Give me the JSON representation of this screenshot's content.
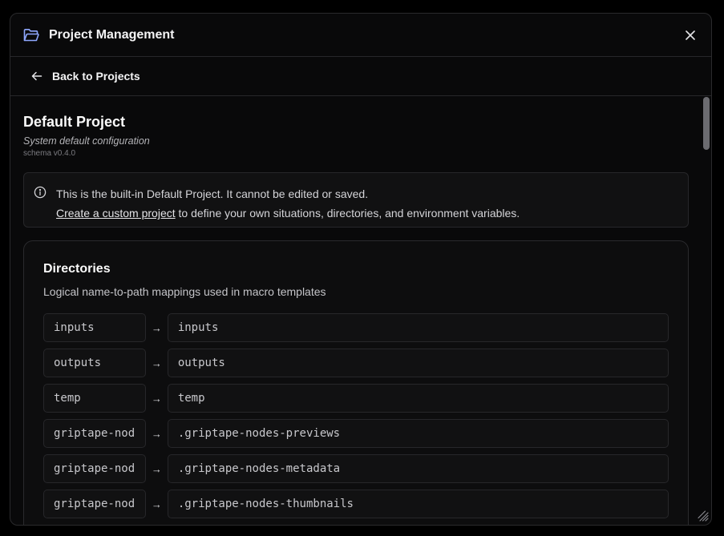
{
  "dialog": {
    "title": "Project Management",
    "close_icon": "close-icon",
    "folder_icon": "folder-open-icon"
  },
  "back": {
    "label": "Back to Projects",
    "icon": "arrow-left-icon"
  },
  "project": {
    "title": "Default Project",
    "description": "System default configuration",
    "schema": "schema v0.4.0"
  },
  "notice": {
    "icon": "info-icon",
    "line1": "This is the built-in Default Project. It cannot be edited or saved.",
    "link_text": "Create a custom project",
    "line2_rest": " to define your own situations, directories, and environment variables."
  },
  "directories": {
    "title": "Directories",
    "description": "Logical name-to-path mappings used in macro templates",
    "arrow": "→",
    "rows": [
      {
        "key": "inputs",
        "value": "inputs"
      },
      {
        "key": "outputs",
        "value": "outputs"
      },
      {
        "key": "temp",
        "value": "temp"
      },
      {
        "key": "griptape-nod",
        "value": ".griptape-nodes-previews"
      },
      {
        "key": "griptape-nod",
        "value": ".griptape-nodes-metadata"
      },
      {
        "key": "griptape-nod",
        "value": ".griptape-nodes-thumbnails"
      }
    ]
  },
  "colors": {
    "background": "#09090a",
    "border": "#27272a",
    "folder_accent": "#8fa8ff",
    "text": "#ececec"
  }
}
